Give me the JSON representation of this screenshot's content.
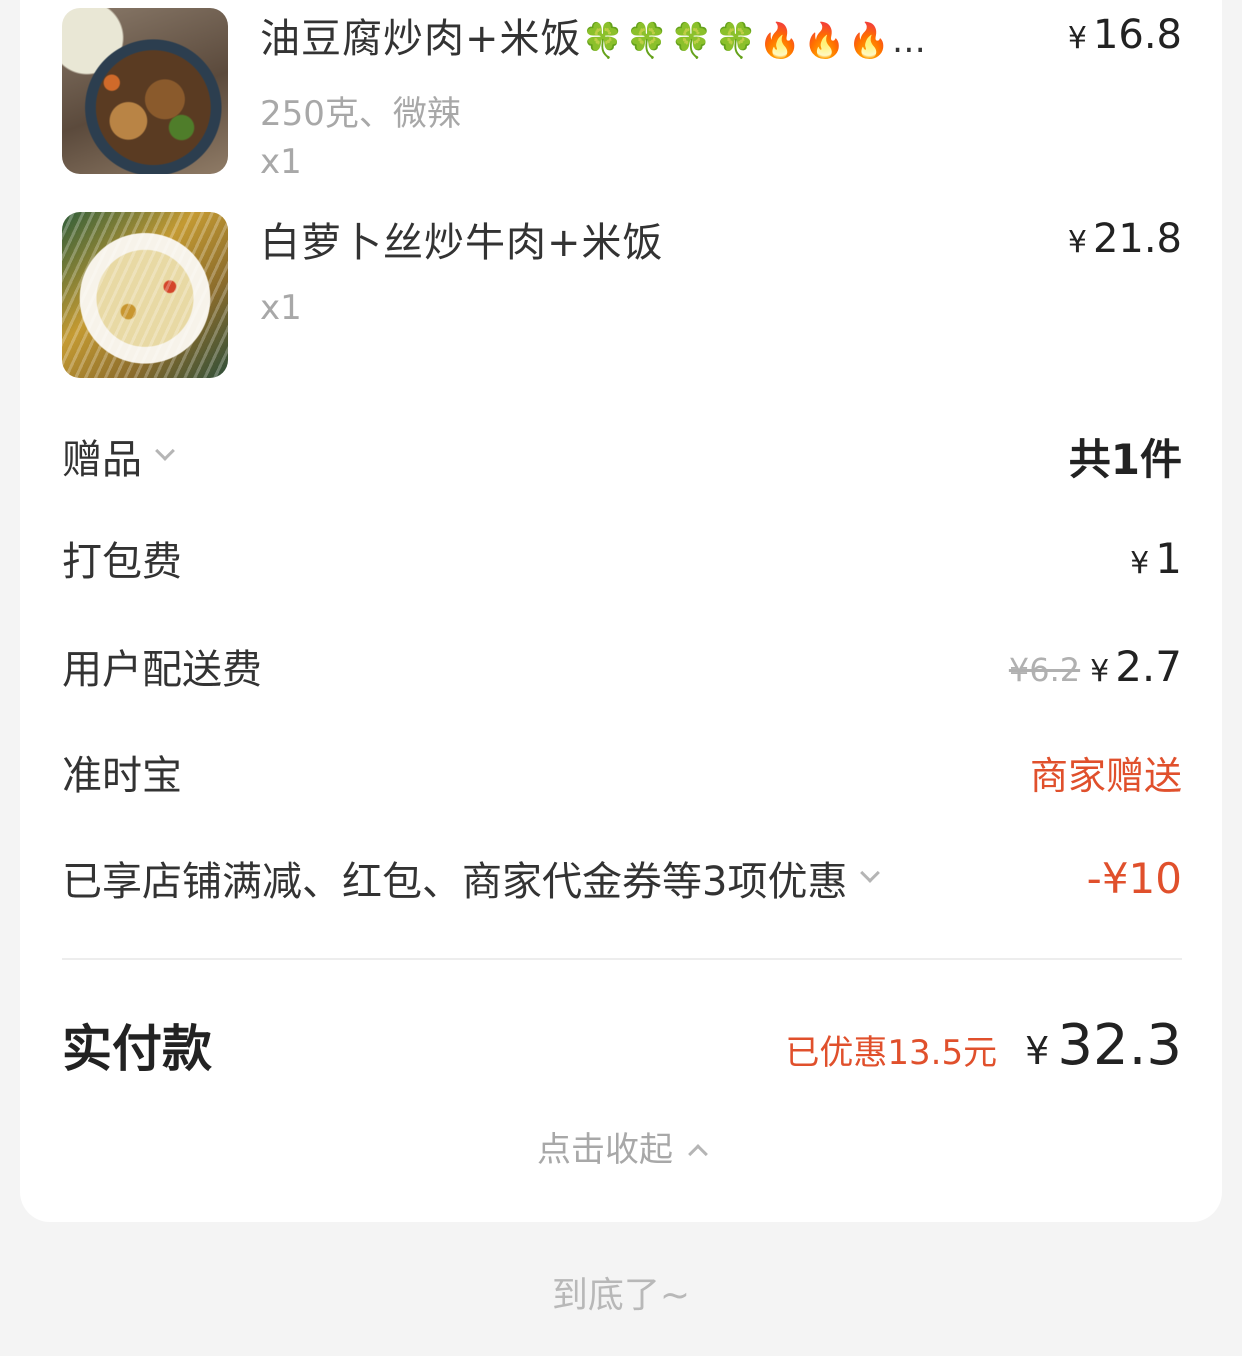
{
  "items": [
    {
      "name": "油豆腐炒肉+米饭",
      "deco": "🍀🍀🍀🍀🔥🔥🔥…",
      "spec": "250克、微辣",
      "qty": "x1",
      "currency": "¥",
      "price": "16.8",
      "image_icon": "dish-tofu-pork-image"
    },
    {
      "name": "白萝卜丝炒牛肉+米饭",
      "qty": "x1",
      "currency": "¥",
      "price": "21.8",
      "image_icon": "dish-radish-beef-image"
    }
  ],
  "gift": {
    "label": "赠品",
    "value": "共1件"
  },
  "packing": {
    "label": "打包费",
    "currency": "¥",
    "value": "1"
  },
  "delivery": {
    "label": "用户配送费",
    "original": "¥6.2",
    "currency": "¥",
    "value": "2.7"
  },
  "ontime": {
    "label": "准时宝",
    "value": "商家赠送"
  },
  "discounts": {
    "label": "已享店铺满减、红包、商家代金券等3项优惠",
    "value": "-¥10"
  },
  "total": {
    "label": "实付款",
    "saved": "已优惠13.5元",
    "currency": "¥",
    "value": "32.3"
  },
  "collapse_label": "点击收起",
  "end_label": "到底了~",
  "colors": {
    "accent_red": "#e0502c",
    "muted": "#a8a8a8",
    "background": "#f4f4f4"
  }
}
